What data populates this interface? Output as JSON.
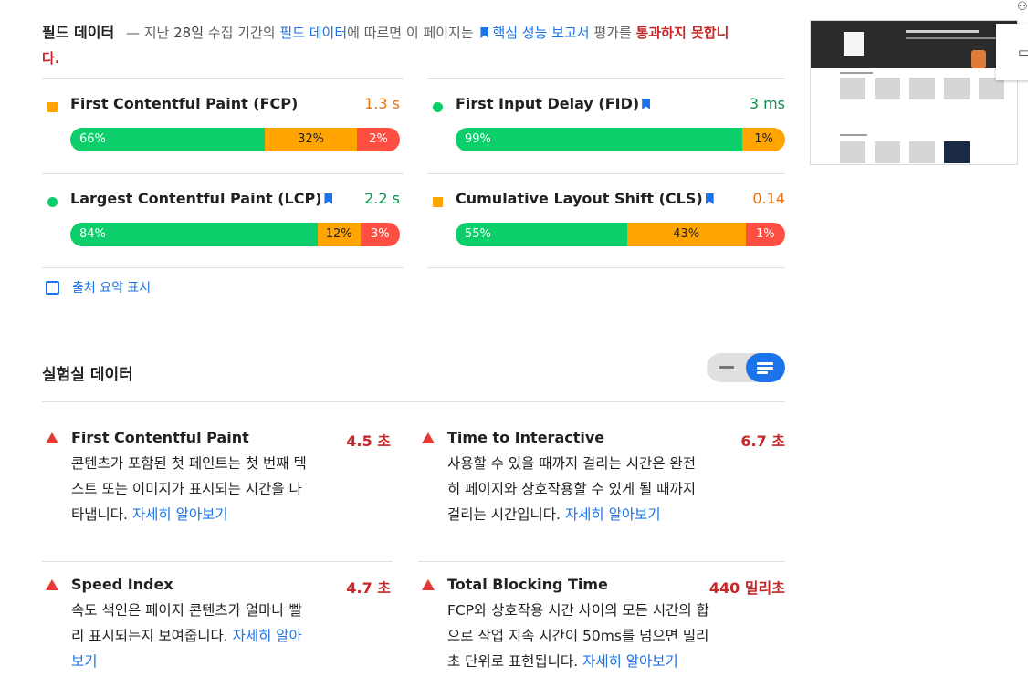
{
  "field_data": {
    "title": "필드 데이터",
    "dash": "—",
    "prefix": "지난",
    "days": "28일",
    "period_text": "수집 기간의",
    "link": "필드 데이터",
    "middle": "에 따르면 이 페이지는",
    "report_link": "핵심 성능 보고서",
    "eval_text": "평가를",
    "fail_text": "통과하지 못합니다",
    "period_end": ".",
    "metrics": [
      {
        "name": "First Contentful Paint (FCP)",
        "value": "1.3 s",
        "status": "average",
        "bookmark": false,
        "dist": {
          "good": "66%",
          "avg": "32%",
          "poor": "2%"
        }
      },
      {
        "name": "First Input Delay (FID)",
        "value": "3 ms",
        "status": "good",
        "bookmark": true,
        "dist": {
          "good": "99%",
          "avg": "1%",
          "poor": ""
        }
      },
      {
        "name": "Largest Contentful Paint (LCP)",
        "value": "2.2 s",
        "status": "good",
        "bookmark": true,
        "dist": {
          "good": "84%",
          "avg": "12%",
          "poor": "3%"
        }
      },
      {
        "name": "Cumulative Layout Shift (CLS)",
        "value": "0.14",
        "status": "average",
        "bookmark": true,
        "dist": {
          "good": "55%",
          "avg": "43%",
          "poor": "1%"
        }
      }
    ],
    "show_origin_label": "출처 요약 표시"
  },
  "lab_data": {
    "title": "실험실 데이터",
    "learn_more": "자세히 알아보기",
    "metrics": [
      {
        "name": "First Contentful Paint",
        "value": "4.5 초",
        "desc": "콘텐츠가 포함된 첫 페인트는 첫 번째 텍스트 또는 이미지가 표시되는 시간을 나타냅니다."
      },
      {
        "name": "Time to Interactive",
        "value": "6.7 초",
        "desc": "사용할 수 있을 때까지 걸리는 시간은 완전히 페이지와 상호작용할 수 있게 될 때까지 걸리는 시간입니다."
      },
      {
        "name": "Speed Index",
        "value": "4.7 초",
        "desc": "속도 색인은 페이지 콘텐츠가 얼마나 빨리 표시되는지 보여줍니다."
      },
      {
        "name": "Total Blocking Time",
        "value": "440 밀리초",
        "desc": "FCP와 상호작용 시간 사이의 모든 시간의 합으로 작업 지속 시간이 50ms를 넘으면 밀리초 단위로 표현됩니다."
      }
    ]
  },
  "colors": {
    "good": "#0cce6b",
    "average": "#ffa400",
    "poor": "#ff4e42",
    "link": "#1a73e8",
    "fail": "#c62828"
  },
  "icons": {
    "side_user": "user-icon",
    "side_card": "desktop-icon"
  }
}
